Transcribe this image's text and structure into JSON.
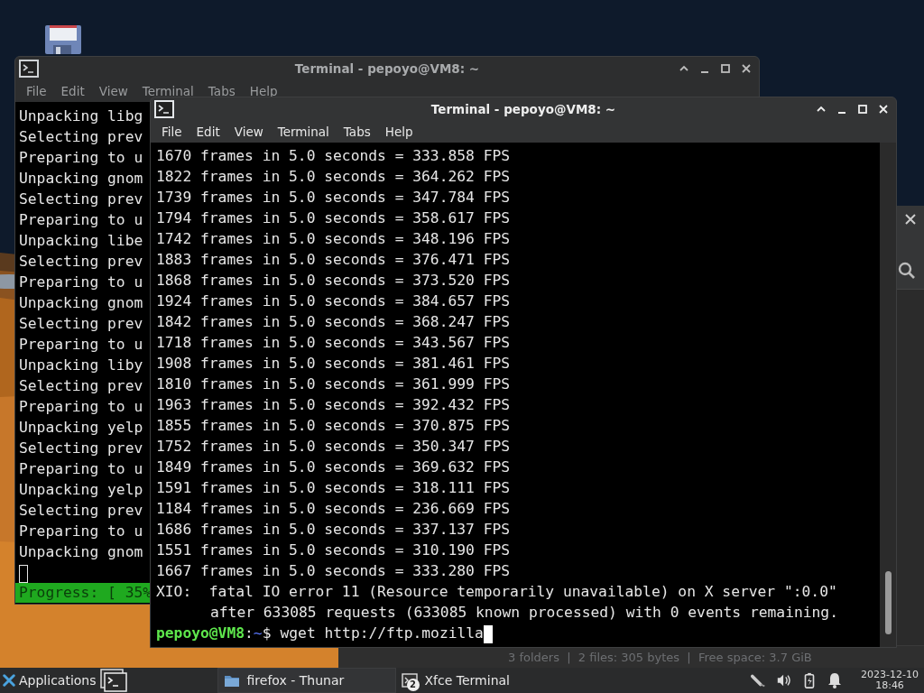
{
  "back_terminal": {
    "title": "Terminal - pepoyo@VM8: ~",
    "menu": [
      "File",
      "Edit",
      "View",
      "Terminal",
      "Tabs",
      "Help"
    ],
    "lines": [
      "Unpacking libg",
      "Selecting prev",
      "Preparing to u",
      "Unpacking gnom",
      "Selecting prev",
      "Preparing to u",
      "Unpacking libe",
      "Selecting prev",
      "Preparing to u",
      "Unpacking gnom",
      "Selecting prev",
      "Preparing to u",
      "Unpacking liby",
      "Selecting prev",
      "Preparing to u",
      "Unpacking yelp",
      "Selecting prev",
      "Preparing to u",
      "Unpacking yelp",
      "Selecting prev",
      "Preparing to u",
      "Unpacking gnom"
    ],
    "progress": "Progress: [ 35%"
  },
  "file_manager": {
    "status": "3 folders  |  2 files: 305 bytes  |  Free space: 3.7 GiB"
  },
  "front_terminal": {
    "title": "Terminal - pepoyo@VM8: ~",
    "menu": [
      "File",
      "Edit",
      "View",
      "Terminal",
      "Tabs",
      "Help"
    ],
    "lines": [
      {
        "text": "1670 frames in 5.0 seconds = 333.858 FPS",
        "kind": "output"
      },
      {
        "text": "1822 frames in 5.0 seconds = 364.262 FPS",
        "kind": "output"
      },
      {
        "text": "1739 frames in 5.0 seconds = 347.784 FPS",
        "kind": "output"
      },
      {
        "text": "1794 frames in 5.0 seconds = 358.617 FPS",
        "kind": "output"
      },
      {
        "text": "1742 frames in 5.0 seconds = 348.196 FPS",
        "kind": "output"
      },
      {
        "text": "1883 frames in 5.0 seconds = 376.471 FPS",
        "kind": "output"
      },
      {
        "text": "1868 frames in 5.0 seconds = 373.520 FPS",
        "kind": "output"
      },
      {
        "text": "1924 frames in 5.0 seconds = 384.657 FPS",
        "kind": "output"
      },
      {
        "text": "1842 frames in 5.0 seconds = 368.247 FPS",
        "kind": "output"
      },
      {
        "text": "1718 frames in 5.0 seconds = 343.567 FPS",
        "kind": "output"
      },
      {
        "text": "1908 frames in 5.0 seconds = 381.461 FPS",
        "kind": "output"
      },
      {
        "text": "1810 frames in 5.0 seconds = 361.999 FPS",
        "kind": "output"
      },
      {
        "text": "1963 frames in 5.0 seconds = 392.432 FPS",
        "kind": "output"
      },
      {
        "text": "1855 frames in 5.0 seconds = 370.875 FPS",
        "kind": "output"
      },
      {
        "text": "1752 frames in 5.0 seconds = 350.347 FPS",
        "kind": "output"
      },
      {
        "text": "1849 frames in 5.0 seconds = 369.632 FPS",
        "kind": "output"
      },
      {
        "text": "1591 frames in 5.0 seconds = 318.111 FPS",
        "kind": "output"
      },
      {
        "text": "1184 frames in 5.0 seconds = 236.669 FPS",
        "kind": "output"
      },
      {
        "text": "1686 frames in 5.0 seconds = 337.137 FPS",
        "kind": "output"
      },
      {
        "text": "1551 frames in 5.0 seconds = 310.190 FPS",
        "kind": "output"
      },
      {
        "text": "1667 frames in 5.0 seconds = 333.280 FPS",
        "kind": "output"
      },
      {
        "text": "XIO:  fatal IO error 11 (Resource temporarily unavailable) on X server \":0.0\"",
        "kind": "output"
      },
      {
        "text": "after 633085 requests (633085 known processed) with 0 events remaining.",
        "kind": "continued"
      }
    ],
    "prompt": {
      "user_host": "pepoyo@VM8",
      "separator": ":",
      "path": "~",
      "symbol": "$",
      "command": "wget http://ftp.mozilla"
    }
  },
  "taskbar": {
    "menu_label": "Applications",
    "tasks": [
      {
        "label": "firefox - Thunar",
        "kind": "folder"
      },
      {
        "label": "Xfce Terminal",
        "kind": "terminal",
        "badge": "2"
      }
    ],
    "clock": {
      "date": "2023-12-10",
      "time": "18:46"
    }
  }
}
